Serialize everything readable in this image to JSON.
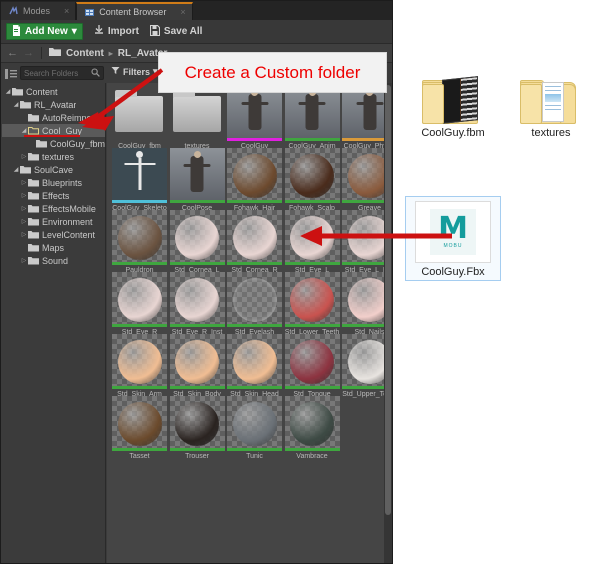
{
  "window": {
    "tabs": [
      {
        "label": "Modes",
        "icon": "modes-icon",
        "active": false,
        "close": "×"
      },
      {
        "label": "Content Browser",
        "icon": "content-browser-icon",
        "active": true,
        "close": "×"
      }
    ]
  },
  "toolbar": {
    "add_new_label": "Add New",
    "add_new_caret": "▾",
    "import_label": "Import",
    "save_all_label": "Save All"
  },
  "breadcrumb": {
    "back_arrow": "←",
    "forward_arrow": "→",
    "items": [
      "Content",
      "RL_Avatar"
    ],
    "separator": "▸"
  },
  "search": {
    "placeholder": "Search Folders",
    "icon": "search-icon",
    "filters_label": "Filters",
    "filters_caret": "▾"
  },
  "tree": [
    {
      "label": "Content",
      "depth": 0,
      "state": "open",
      "selected": false
    },
    {
      "label": "RL_Avatar",
      "depth": 1,
      "state": "open",
      "selected": false
    },
    {
      "label": "AutoReimport",
      "depth": 2,
      "state": "leaf",
      "selected": false
    },
    {
      "label": "Cool_Guy",
      "depth": 2,
      "state": "open",
      "selected": true
    },
    {
      "label": "CoolGuy_fbm",
      "depth": 3,
      "state": "leaf",
      "selected": false
    },
    {
      "label": "textures",
      "depth": 2,
      "state": "closed",
      "selected": false
    },
    {
      "label": "SoulCave",
      "depth": 1,
      "state": "open",
      "selected": false
    },
    {
      "label": "Blueprints",
      "depth": 2,
      "state": "closed",
      "selected": false
    },
    {
      "label": "Effects",
      "depth": 2,
      "state": "closed",
      "selected": false
    },
    {
      "label": "EffectsMobile",
      "depth": 2,
      "state": "closed",
      "selected": false
    },
    {
      "label": "Environment",
      "depth": 2,
      "state": "closed",
      "selected": false
    },
    {
      "label": "LevelContent",
      "depth": 2,
      "state": "closed",
      "selected": false
    },
    {
      "label": "Maps",
      "depth": 2,
      "state": "leaf",
      "selected": false
    },
    {
      "label": "Sound",
      "depth": 2,
      "state": "closed",
      "selected": false
    }
  ],
  "assets": [
    {
      "label": "CoolGuy_fbm",
      "kind": "folder",
      "bar": ""
    },
    {
      "label": "textures",
      "kind": "folder",
      "bar": ""
    },
    {
      "label": "CoolGuy",
      "kind": "mesh",
      "bar": "#e020e0"
    },
    {
      "label": "CoolGuy_Anim",
      "kind": "mesh",
      "bar": "#3fa63f"
    },
    {
      "label": "CoolGuy_PhysicsAsset",
      "kind": "mesh",
      "bar": "#d99a3a"
    },
    {
      "label": "CoolGuy_Skeleton",
      "kind": "skeleton",
      "bar": "#4fc0d9"
    },
    {
      "label": "CoolPose",
      "kind": "mesh",
      "bar": "#3fa63f"
    },
    {
      "label": "Fohawk_Hair",
      "kind": "material",
      "bar": "#3fa63f",
      "color": "#6d4a2e"
    },
    {
      "label": "Fohawk_Scalp",
      "kind": "material",
      "bar": "#3fa63f",
      "color": "#4a2b1b"
    },
    {
      "label": "Greave",
      "kind": "material",
      "bar": "#3fa63f",
      "color": "#8a5a3c"
    },
    {
      "label": "Pauldron",
      "kind": "material",
      "bar": "#3fa63f",
      "color": "#6b5340"
    },
    {
      "label": "Std_Cornea_L",
      "kind": "material",
      "bar": "#3fa63f",
      "color": "#e8d5d2"
    },
    {
      "label": "Std_Cornea_R",
      "kind": "material",
      "bar": "#3fa63f",
      "color": "#e8d5d2"
    },
    {
      "label": "Std_Eye_L",
      "kind": "material",
      "bar": "#3fa63f",
      "color": "#e8d5d2"
    },
    {
      "label": "Std_Eye_L_Inst",
      "kind": "material",
      "bar": "#3fa63f",
      "color": "#e8d5d2"
    },
    {
      "label": "Std_Eye_R",
      "kind": "material",
      "bar": "#3fa63f",
      "color": "#e8d5d2"
    },
    {
      "label": "Std_Eye_R_Inst",
      "kind": "material",
      "bar": "#3fa63f",
      "color": "#e8d5d2"
    },
    {
      "label": "Std_Eyelash",
      "kind": "glass",
      "bar": "#3fa63f"
    },
    {
      "label": "Std_Lower_Teeth",
      "kind": "material",
      "bar": "#3fa63f",
      "color": "#c9534f"
    },
    {
      "label": "Std_Nails",
      "kind": "material",
      "bar": "#3fa63f",
      "color": "#f2cfcb"
    },
    {
      "label": "Std_Skin_Arm",
      "kind": "material",
      "bar": "#3fa63f",
      "color": "#f0bd93"
    },
    {
      "label": "Std_Skin_Body",
      "kind": "material",
      "bar": "#3fa63f",
      "color": "#f0bd93"
    },
    {
      "label": "Std_Skin_Head",
      "kind": "material",
      "bar": "#3fa63f",
      "color": "#f0bd93"
    },
    {
      "label": "Std_Tongue",
      "kind": "material",
      "bar": "#3fa63f",
      "color": "#8d3340"
    },
    {
      "label": "Std_Upper_Teeth",
      "kind": "material",
      "bar": "#3fa63f",
      "color": "#e8e4e0"
    },
    {
      "label": "Tasset",
      "kind": "material",
      "bar": "#3fa63f",
      "color": "#6b4a2c"
    },
    {
      "label": "Trouser",
      "kind": "material",
      "bar": "#3fa63f",
      "color": "#2a2320"
    },
    {
      "label": "Tunic",
      "kind": "material",
      "bar": "#3fa63f",
      "color": "#6a7076"
    },
    {
      "label": "Vambrace",
      "kind": "material",
      "bar": "#3fa63f",
      "color": "#3d4a44"
    }
  ],
  "explorer": {
    "items": [
      {
        "label": "CoolGuy.fbm",
        "icon": "folder-contact-sheet-icon",
        "selected": false
      },
      {
        "label": "textures",
        "icon": "folder-pictures-icon",
        "selected": false
      },
      {
        "label": "CoolGuy.Fbx",
        "icon": "motionbuilder-icon",
        "selected": true,
        "icon_text": "M",
        "icon_sub": "MOBU"
      }
    ]
  },
  "annotations": {
    "callout_text": "Create a Custom folder",
    "callout_color": "#ee0000",
    "arrow_color": "#cc1111",
    "arrow_to_folder_name": "arrow-to-cool-guy-folder",
    "arrow_to_fbx_name": "arrow-to-coolguy-fbx"
  },
  "colors": {
    "accent_green": "#2c8a3c",
    "tab_active_top": "#d07c18",
    "panel_bg": "#3b3b3b",
    "grid_bg": "#454545",
    "selection": "#5a5a5a"
  }
}
